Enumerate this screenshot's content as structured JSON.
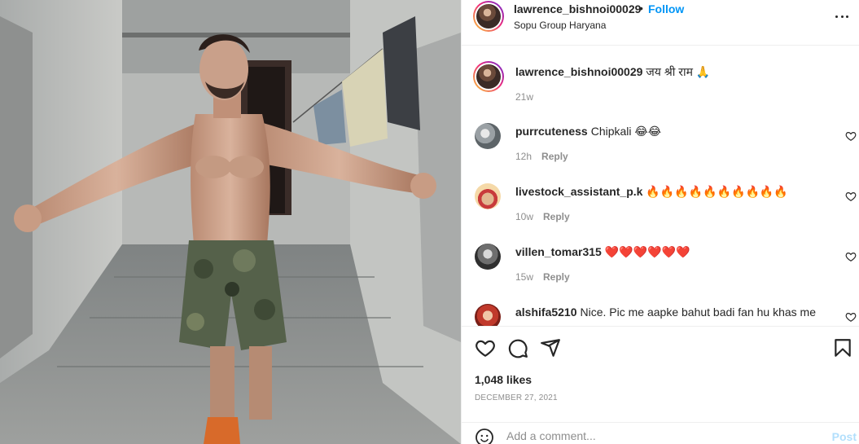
{
  "post": {
    "author": "lawrence_bishnoi00029",
    "follow_label": "Follow",
    "dot": "•",
    "location": "Sopu Group Haryana",
    "caption": "जय श्री राम 🙏",
    "caption_age": "21w"
  },
  "comments": [
    {
      "user": "purrcuteness",
      "text": "Chipkali 😂😂",
      "age": "12h",
      "reply_label": "Reply"
    },
    {
      "user": "livestock_assistant_p.k",
      "text": "🔥🔥🔥🔥🔥🔥🔥🔥🔥🔥",
      "age": "10w",
      "reply_label": "Reply"
    },
    {
      "user": "villen_tomar315",
      "text": "❤️❤️❤️❤️❤️❤️",
      "age": "15w",
      "reply_label": "Reply"
    },
    {
      "user": "alshifa5210",
      "text": "Nice. Pic me aapke bahut badi fan hu khas me",
      "age": "",
      "reply_label": ""
    }
  ],
  "stats": {
    "likes": "1,048 likes",
    "date": "DECEMBER 27, 2021"
  },
  "composer": {
    "placeholder": "Add a comment...",
    "post_label": "Post"
  },
  "icons": {
    "more": "more-options-icon",
    "like": "heart-icon",
    "comment": "comment-icon",
    "share": "share-icon",
    "save": "bookmark-icon",
    "emoji": "emoji-icon"
  },
  "colors": {
    "accent": "#0095f6",
    "post_disabled": "#b2dffc",
    "muted": "#8e8e8e",
    "text": "#262626"
  }
}
